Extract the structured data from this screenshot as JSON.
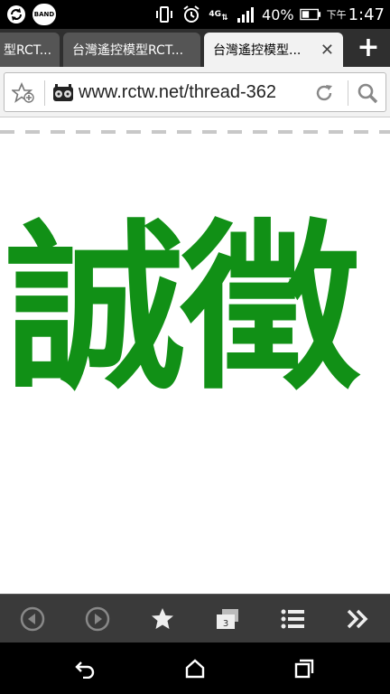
{
  "status_bar": {
    "band_label": "BAND",
    "network_label": "4G",
    "battery_text": "40%",
    "ampm": "下午",
    "time": "1:47"
  },
  "tabs": [
    {
      "title": "型RCT..."
    },
    {
      "title": "台灣遙控模型RCT..."
    },
    {
      "title": "台灣遙控模型...",
      "active": true
    }
  ],
  "tab_close_glyph": "✕",
  "new_tab_glyph": "+",
  "address_bar": {
    "url": "www.rctw.net/thread-362"
  },
  "page": {
    "banner_text": "誠徵",
    "banner_color": "#119016"
  },
  "toolbar": {
    "tab_count": "3"
  },
  "colors": {
    "statusbar": "#000000",
    "tabstrip": "#2f2f2f",
    "active_tab": "#f2f2f2",
    "toolbar": "#3a3a3a"
  }
}
